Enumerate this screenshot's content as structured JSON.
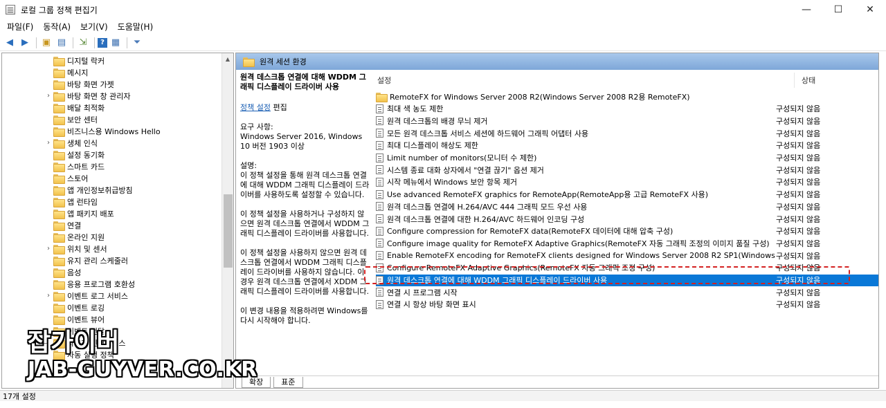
{
  "window": {
    "title": "로컬 그룹 정책 편집기",
    "min": "—",
    "max": "☐",
    "close": "✕"
  },
  "menu": [
    "파일(F)",
    "동작(A)",
    "보기(V)",
    "도움말(H)"
  ],
  "tree": {
    "items": [
      {
        "label": "디지털 락커",
        "exp": ""
      },
      {
        "label": "메시지",
        "exp": ""
      },
      {
        "label": "바탕 화면 가젯",
        "exp": ""
      },
      {
        "label": "바탕 화면 창 관리자",
        "exp": "›"
      },
      {
        "label": "배달 최적화",
        "exp": ""
      },
      {
        "label": "보안 센터",
        "exp": ""
      },
      {
        "label": "비즈니스용 Windows Hello",
        "exp": ""
      },
      {
        "label": "생체 인식",
        "exp": "›"
      },
      {
        "label": "설정 동기화",
        "exp": ""
      },
      {
        "label": "스마트 카드",
        "exp": ""
      },
      {
        "label": "스토어",
        "exp": ""
      },
      {
        "label": "앱 개인정보취급방침",
        "exp": ""
      },
      {
        "label": "앱 런타임",
        "exp": ""
      },
      {
        "label": "앱 패키지 배포",
        "exp": ""
      },
      {
        "label": "연결",
        "exp": ""
      },
      {
        "label": "온라인 지원",
        "exp": ""
      },
      {
        "label": "위치 및 센서",
        "exp": "›"
      },
      {
        "label": "유지 관리 스케줄러",
        "exp": ""
      },
      {
        "label": "음성",
        "exp": ""
      },
      {
        "label": "응용 프로그램 호환성",
        "exp": ""
      },
      {
        "label": "이벤트 로그 서비스",
        "exp": "›"
      },
      {
        "label": "이벤트 로깅",
        "exp": ""
      },
      {
        "label": "이벤트 뷰어",
        "exp": ""
      },
      {
        "label": "이벤트 전달",
        "exp": ""
      },
      {
        "label": "사용자 인터페이스",
        "exp": ""
      },
      {
        "label": "자동 실행 정책",
        "exp": ""
      }
    ]
  },
  "right": {
    "header": "원격 세션 환경",
    "desc": {
      "title": "원격 데스크톱 연결에 대해 WDDM 그래픽 디스플레이 드라이버 사용",
      "link": "정책 설정",
      "link_suffix": " 편집",
      "req": "요구 사항:\nWindows Server 2016, Windows 10 버전 1903 이상",
      "p1": "설명:\n이 정책 설정을 통해 원격 데스크톱 연결에 대해 WDDM 그래픽 디스플레이 드라이버를 사용하도록 설정할 수 있습니다.",
      "p2": "이 정책 설정을 사용하거나 구성하지 않으면 원격 데스크톱 연결에서 WDDM 그래픽 디스플레이 드라이버를 사용합니다.",
      "p3": "이 정책 설정을 사용하지 않으면 원격 데스크톱 연결에서 WDDM 그래픽 디스플레이 드라이버를 사용하지 않습니다. 이 경우 원격 데스크톱 연결에서 XDDM 그래픽 디스플레이 드라이버를 사용합니다.",
      "p4": "이 변경 내용을 적용하려면 Windows를 다시 시작해야 합니다."
    },
    "col_setting": "설정",
    "col_state": "상태",
    "rows": [
      {
        "setting": "RemoteFX for Windows Server 2008 R2(Windows Server 2008 R2용 RemoteFX)",
        "state": "",
        "type": "folder"
      },
      {
        "setting": "최대 색 농도 제한",
        "state": "구성되지 않음",
        "type": "policy"
      },
      {
        "setting": "원격 데스크톱의 배경 무늬 제거",
        "state": "구성되지 않음",
        "type": "policy"
      },
      {
        "setting": "모든 원격 데스크톱 서비스 세션에 하드웨어 그래픽 어댑터 사용",
        "state": "구성되지 않음",
        "type": "policy"
      },
      {
        "setting": "최대 디스플레이 해상도 제한",
        "state": "구성되지 않음",
        "type": "policy"
      },
      {
        "setting": "Limit number of monitors(모니터 수 제한)",
        "state": "구성되지 않음",
        "type": "policy"
      },
      {
        "setting": "시스템 종료 대화 상자에서 \"연결 끊기\" 옵션 제거",
        "state": "구성되지 않음",
        "type": "policy"
      },
      {
        "setting": "시작 메뉴에서 Windows 보안 항목 제거",
        "state": "구성되지 않음",
        "type": "policy"
      },
      {
        "setting": "Use advanced RemoteFX graphics for RemoteApp(RemoteApp용 고급 RemoteFX 사용)",
        "state": "구성되지 않음",
        "type": "policy"
      },
      {
        "setting": "원격 데스크톱 연결에 H.264/AVC 444 그래픽 모드 우선 사용",
        "state": "구성되지 않음",
        "type": "policy"
      },
      {
        "setting": "원격 데스크톱 연결에 대한 H.264/AVC 하드웨어 인코딩 구성",
        "state": "구성되지 않음",
        "type": "policy"
      },
      {
        "setting": "Configure compression for RemoteFX data(RemoteFX 데이터에 대해 압축 구성)",
        "state": "구성되지 않음",
        "type": "policy"
      },
      {
        "setting": "Configure image quality for RemoteFX Adaptive Graphics(RemoteFX 자동 그래픽 조정의 이미지 품질 구성)",
        "state": "구성되지 않음",
        "type": "policy"
      },
      {
        "setting": "Enable RemoteFX encoding for RemoteFX clients designed for Windows Server 2008 R2 SP1(Windows Serv...",
        "state": "구성되지 않음",
        "type": "policy"
      },
      {
        "setting": "Configure RemoteFX Adaptive Graphics(RemoteFX 자동 그래픽 조정 구성)",
        "state": "구성되지 않음",
        "type": "policy"
      },
      {
        "setting": "원격 데스크톱 연결에 대해 WDDM 그래픽 디스플레이 드라이버 사용",
        "state": "구성되지 않음",
        "type": "policy",
        "selected": true
      },
      {
        "setting": "연결 시 프로그램 시작",
        "state": "구성되지 않음",
        "type": "policy"
      },
      {
        "setting": "연결 시 항상 바탕 화면 표시",
        "state": "구성되지 않음",
        "type": "policy"
      }
    ],
    "tabs": [
      "확장",
      "표준"
    ]
  },
  "status": "17개 설정",
  "watermark": {
    "line1": "잡가이버",
    "line2": "JAB-GUYVER.CO.KR"
  }
}
